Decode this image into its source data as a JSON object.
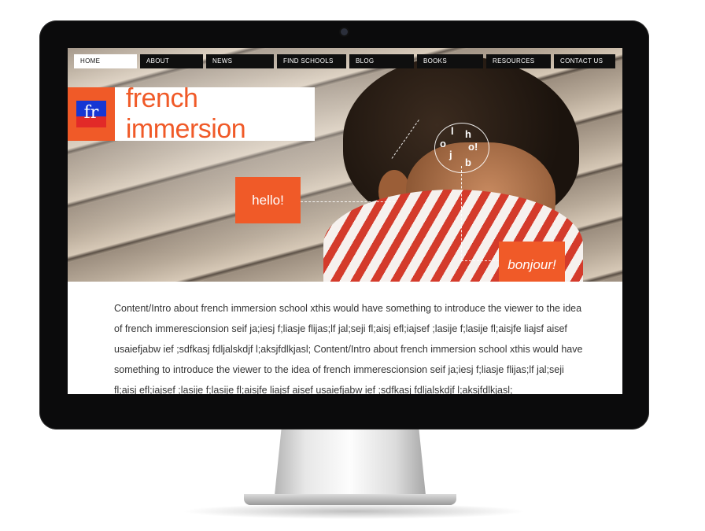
{
  "nav": {
    "items": [
      {
        "label": "HOME",
        "active": true
      },
      {
        "label": "ABOUT",
        "active": false
      },
      {
        "label": "NEWS",
        "active": false
      },
      {
        "label": "FIND SCHOOLS",
        "active": false
      },
      {
        "label": "BLOG",
        "active": false
      },
      {
        "label": "BOOKS",
        "active": false
      },
      {
        "label": "RESOURCES",
        "active": false
      },
      {
        "label": "CONTACT US",
        "active": false
      }
    ]
  },
  "logo": {
    "mark_text": "fr",
    "name": "french immersion"
  },
  "hero": {
    "hello": "hello!",
    "bonjour": "bonjour!",
    "circle_letters": [
      "l",
      "o",
      "h",
      "o!",
      "j",
      "b"
    ]
  },
  "content": {
    "intro": "Content/Intro about french immersion school xthis would have something to introduce the viewer to the idea of french immerescionsion seif ja;iesj f;liasje flijas;lf jal;seji fl;aisj efl;iajsef ;lasije f;lasije fl;aisjfe liajsf aisef usaiefjabw ief ;sdfkasj fdljalskdjf l;aksjfdlkjasl; Content/Intro about french immersion school xthis would have something to introduce the viewer to the idea of french immerescionsion seif ja;iesj f;liasje flijas;lf jal;seji fl;aisj efl;iajsef ;lasije f;lasije fl;aisjfe liajsf aisef usaiefjabw ief ;sdfkasj fdljalskdjf l;aksjfdlkjasl;"
  },
  "colors": {
    "accent": "#f05a28",
    "nav_bg": "#0f0f0f",
    "flag_blue": "#1636d4",
    "flag_red": "#e22a28"
  }
}
